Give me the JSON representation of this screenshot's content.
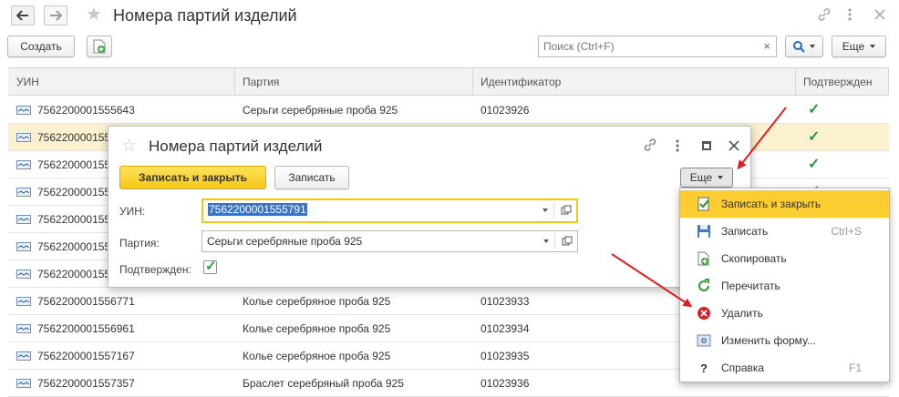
{
  "window": {
    "title": "Номера партий изделий"
  },
  "toolbar": {
    "create_label": "Создать",
    "search_placeholder": "Поиск (Ctrl+F)",
    "clear_label": "×",
    "more_label": "Еще"
  },
  "table": {
    "columns": [
      "УИН",
      "Партия",
      "Идентификатор",
      "Подтвержден"
    ],
    "rows": [
      {
        "uin": "7562200001555643",
        "party": "Серьги серебряные проба 925",
        "id": "01023926",
        "confirmed": "✓"
      },
      {
        "uin": "756220000155",
        "party": "",
        "id": "",
        "confirmed": "✓"
      },
      {
        "uin": "756220000155",
        "party": "",
        "id": "",
        "confirmed": "✓"
      },
      {
        "uin": "756220000155",
        "party": "",
        "id": "",
        "confirmed": "✓"
      },
      {
        "uin": "756220000155",
        "party": "",
        "id": "",
        "confirmed": ""
      },
      {
        "uin": "756220000155",
        "party": "",
        "id": "",
        "confirmed": ""
      },
      {
        "uin": "756220000155",
        "party": "",
        "id": "",
        "confirmed": ""
      },
      {
        "uin": "7562200001556771",
        "party": "Колье серебряное проба 925",
        "id": "01023933",
        "confirmed": ""
      },
      {
        "uin": "7562200001556961",
        "party": "Колье серебряное проба 925",
        "id": "01023934",
        "confirmed": ""
      },
      {
        "uin": "7562200001557167",
        "party": "Колье серебряное проба 925",
        "id": "01023935",
        "confirmed": ""
      },
      {
        "uin": "7562200001557357",
        "party": "Браслет серебряный проба 925",
        "id": "01023936",
        "confirmed": ""
      }
    ]
  },
  "dialog": {
    "title": "Номера партий изделий",
    "save_close_label": "Записать и закрыть",
    "save_label": "Записать",
    "more_label": "Еще",
    "uin_label": "УИН:",
    "uin_value": "7562200001555791",
    "party_label": "Партия:",
    "party_value": "Серьги серебряные проба 925",
    "confirmed_label": "Подтвержден:",
    "confirmed_mark": "✓"
  },
  "menu": {
    "items": [
      {
        "label": "Записать и закрыть",
        "shortcut": "",
        "icon": "save-close-icon"
      },
      {
        "label": "Записать",
        "shortcut": "Ctrl+S",
        "icon": "floppy-icon"
      },
      {
        "label": "Скопировать",
        "shortcut": "",
        "icon": "copy-icon"
      },
      {
        "label": "Перечитать",
        "shortcut": "",
        "icon": "refresh-icon"
      },
      {
        "label": "Удалить",
        "shortcut": "",
        "icon": "delete-icon"
      },
      {
        "label": "Изменить форму...",
        "shortcut": "",
        "icon": "form-settings-icon"
      },
      {
        "label": "Справка",
        "shortcut": "F1",
        "icon": "help-icon"
      }
    ]
  },
  "colors": {
    "accent_yellow": "#f5c714",
    "selected_row": "#fbf0cf",
    "check_green": "#2d9a3c",
    "arrow_red": "#e02020"
  }
}
